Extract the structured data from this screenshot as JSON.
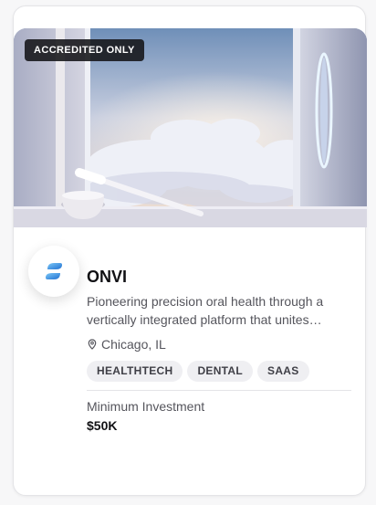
{
  "badge": "ACCREDITED ONLY",
  "company": {
    "name": "ONVI",
    "description": "Pioneering precision oral health through a vertically integrated platform that unites precision diagnostics and care.",
    "location": "Chicago, IL",
    "tags": [
      "HEALTHTECH",
      "DENTAL",
      "SAAS"
    ]
  },
  "investment": {
    "label": "Minimum Investment",
    "value": "$50K"
  },
  "icons": {
    "location": "map-pin-icon",
    "logo": "onvi-logo-icon"
  },
  "colors": {
    "brand_blue": "#2f8fe0",
    "badge_bg": "#141418",
    "tag_bg": "#efeff2"
  }
}
